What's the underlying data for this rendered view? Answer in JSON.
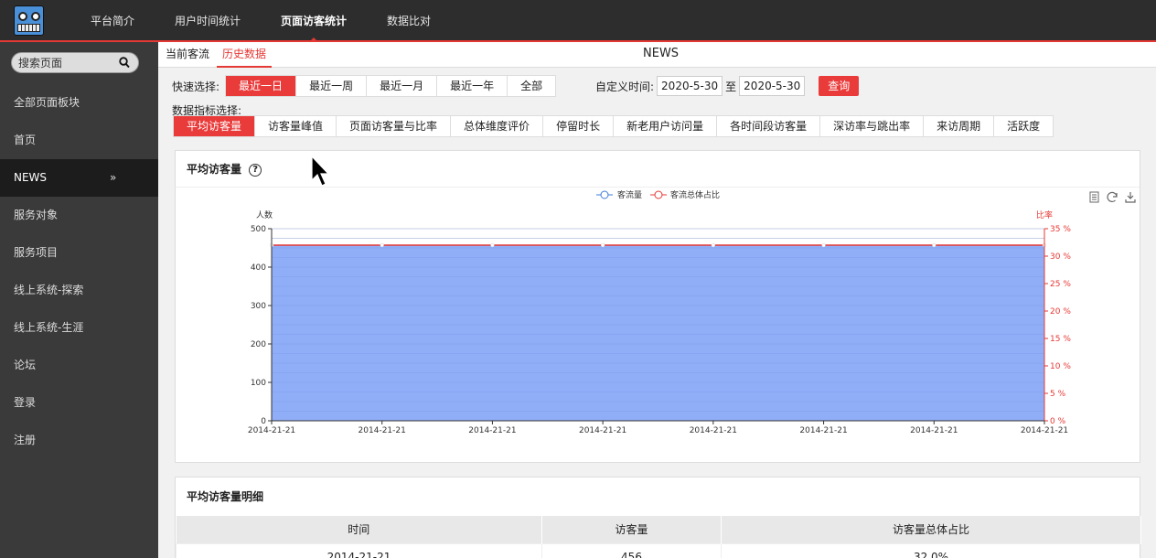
{
  "topnav": [
    "平台简介",
    "用户时间统计",
    "页面访客统计",
    "数据比对"
  ],
  "search": {
    "placeholder": "搜索页面"
  },
  "sidebar": [
    {
      "label": "全部页面板块",
      "active": false
    },
    {
      "label": "首页",
      "active": false
    },
    {
      "label": "NEWS",
      "active": true,
      "chevron": "»"
    },
    {
      "label": "服务对象",
      "active": false
    },
    {
      "label": "服务项目",
      "active": false
    },
    {
      "label": "线上系统-探索",
      "active": false
    },
    {
      "label": "线上系统-生涯",
      "active": false
    },
    {
      "label": "论坛",
      "active": false
    },
    {
      "label": "登录",
      "active": false
    },
    {
      "label": "注册",
      "active": false
    }
  ],
  "subtabs": [
    "当前客流",
    "历史数据"
  ],
  "page_title": "NEWS",
  "quick": {
    "label": "快速选择:",
    "options": [
      "最近一日",
      "最近一周",
      "最近一月",
      "最近一年",
      "全部"
    ]
  },
  "custom": {
    "label": "自定义时间:",
    "from": "2020-5-30",
    "to_label": "至",
    "to": "2020-5-30",
    "query": "查询"
  },
  "metric_label": "数据指标选择:",
  "metrics": [
    "平均访客量",
    "访客量峰值",
    "页面访客量与比率",
    "总体维度评价",
    "停留时长",
    "新老用户访问量",
    "各时间段访客量",
    "深访率与跳出率",
    "来访周期",
    "活跃度"
  ],
  "card": {
    "title": "平均访客量",
    "help": "?"
  },
  "chart_data": {
    "type": "area",
    "categories": [
      "2014-21-21",
      "2014-21-21",
      "2014-21-21",
      "2014-21-21",
      "2014-21-21",
      "2014-21-21",
      "2014-21-21",
      "2014-21-21"
    ],
    "series": [
      {
        "name": "客流量",
        "values": [
          456,
          456,
          456,
          456,
          456,
          456,
          456,
          456
        ],
        "axis": "left",
        "color": "#3f7bd9",
        "fill": "#8aa9f7"
      },
      {
        "name": "客流总体占比",
        "values": [
          32,
          32,
          32,
          32,
          32,
          32,
          32,
          32
        ],
        "axis": "right",
        "color": "#e53935"
      }
    ],
    "ylabel": "人数",
    "y2label": "比率",
    "ylim": [
      0,
      500
    ],
    "yticks": [
      0,
      100,
      200,
      300,
      400,
      500
    ],
    "y2lim": [
      0,
      35
    ],
    "y2ticks": [
      "0 %",
      "5 %",
      "10 %",
      "15 %",
      "20 %",
      "25 %",
      "30 %",
      "35 %"
    ],
    "legend": "top-center",
    "toolbar_icons": [
      "data-view-icon",
      "refresh-icon",
      "download-icon"
    ]
  },
  "detail": {
    "title": "平均访客量明细",
    "columns": [
      "时间",
      "访客量",
      "访客量总体占比"
    ],
    "rows": [
      [
        "2014-21-21",
        "456",
        "32.0%"
      ]
    ]
  }
}
